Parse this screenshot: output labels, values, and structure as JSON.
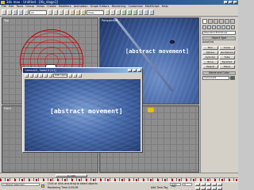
{
  "app": {
    "title": "3ds max - Untitled - [Ab_stage1]",
    "window_buttons": [
      "_",
      "□",
      "×"
    ]
  },
  "menubar": {
    "items": [
      "File",
      "Edit",
      "Tools",
      "Group",
      "Views",
      "Create",
      "Modifiers",
      "Animation",
      "Graph Editors",
      "Rendering",
      "Customize",
      "MAXScript",
      "Help"
    ]
  },
  "toolbar": {
    "selection_filter": "All",
    "view_dropdown": "View"
  },
  "viewports": {
    "top_left": {
      "label": "Top",
      "icons": [
        "sphere-wireframe",
        "camera-icon",
        "target-icon"
      ]
    },
    "top_right": {
      "label": "Perspective",
      "caption": "[abstract movement]"
    },
    "bottom_left": {
      "label": "Front"
    },
    "bottom_right": {
      "label": "Left"
    }
  },
  "render_window": {
    "title": "Camera01, frame 0 (1:1)",
    "channel_dropdown": "RGB Alpha",
    "caption": "[abstract movement]"
  },
  "command_panel": {
    "category_dropdown": "Standard Primitives",
    "rollout_object_type": "Object Type",
    "autogrid": "AutoGrid",
    "object_buttons": [
      "Box",
      "Cone",
      "Sphere",
      "GeoSphere",
      "Cylinder",
      "Tube",
      "Torus",
      "Pyramid",
      "Teapot",
      "Plane"
    ],
    "rollout_name_color": "Name and Color",
    "object_name": "Camera01"
  },
  "timeline": {
    "slider_label": "0 / 100"
  },
  "statusbar": {
    "selection": "1 Object Selected",
    "prompt": "Click or click-and-drag to select objects",
    "rendering_time": "Rendering Time 0:00:08",
    "add_time_tag": "Add Time Tag",
    "frame": "0",
    "key_mode": "Auto Key"
  }
}
